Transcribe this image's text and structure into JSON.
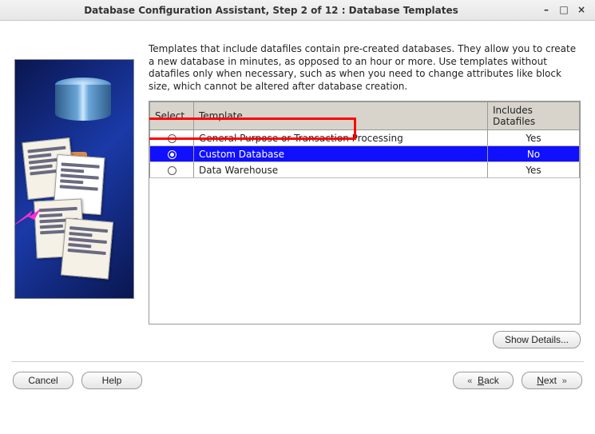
{
  "window": {
    "title": "Database Configuration Assistant, Step 2 of 12 : Database Templates"
  },
  "description": "Templates that include datafiles contain pre-created databases. They allow you to create a new database in minutes, as opposed to an hour or more. Use templates without datafiles only when necessary, such as when you need to change attributes like block size, which cannot be altered after database creation.",
  "table": {
    "headers": {
      "select": "Select",
      "template": "Template",
      "includes": "Includes Datafiles"
    },
    "rows": [
      {
        "template": "General Purpose or Transaction Processing",
        "includes": "Yes",
        "selected": false
      },
      {
        "template": "Custom Database",
        "includes": "No",
        "selected": true
      },
      {
        "template": "Data Warehouse",
        "includes": "Yes",
        "selected": false
      }
    ]
  },
  "buttons": {
    "show_details": "Show Details...",
    "cancel": "Cancel",
    "help": "Help",
    "back": "Back",
    "next": "Next"
  },
  "highlight": {
    "row_index": 1
  }
}
